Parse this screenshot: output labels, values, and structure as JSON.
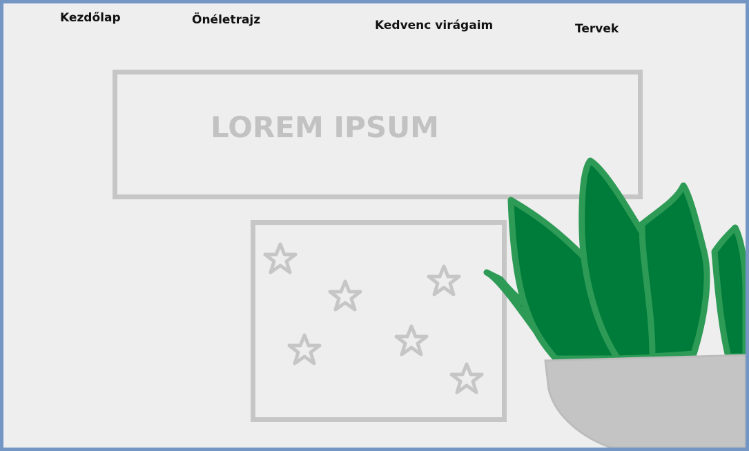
{
  "nav": {
    "items": [
      {
        "label": "Kezdőlap"
      },
      {
        "label": "Önéletrajz"
      },
      {
        "label": "Kedvenc virágaim"
      },
      {
        "label": "Tervek"
      }
    ]
  },
  "hero": {
    "title": "LOREM IPSUM"
  },
  "colors": {
    "frame_border": "#7396c4",
    "background": "#eeeeee",
    "placeholder_gray": "#c6c6c6",
    "leaf_green": "#007c3a",
    "leaf_outline": "#2d9a56",
    "pot_gray": "#c4c4c4"
  },
  "image_placeholder": {
    "icon": "star-icon",
    "star_count": 6
  },
  "illustration": {
    "subject": "potted-plant"
  }
}
